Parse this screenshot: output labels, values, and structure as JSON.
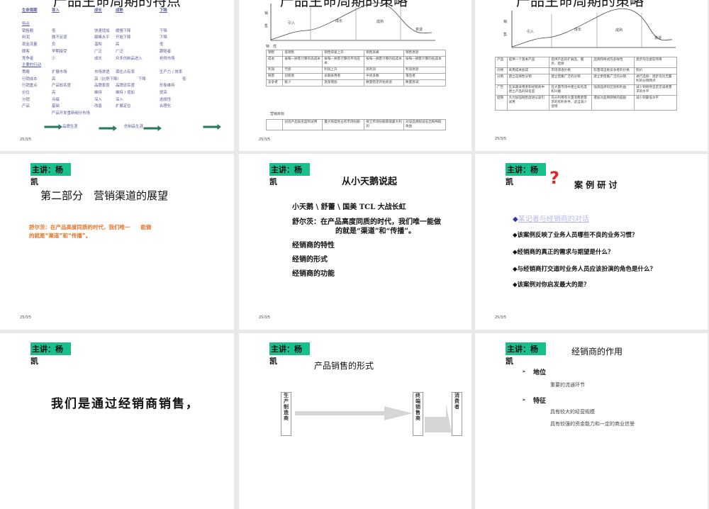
{
  "footer_date": "25/3/5",
  "speaker": {
    "line1": "主讲：杨",
    "line2": "凯"
  },
  "s1": {
    "title": "产品生命周期的特点",
    "header": [
      "生命周期",
      "导入",
      "成长",
      "成熟",
      "下降"
    ],
    "sec1": "特点",
    "rows1": [
      [
        "销售额",
        "低",
        "快速增加",
        "缓慢下降",
        "下降"
      ],
      [
        "利润",
        "微不足道",
        "巅峰水平",
        "开始下降",
        "下降"
      ],
      [
        "现金流量",
        "负",
        "温和",
        "高",
        "低"
      ],
      [
        "顾客",
        "早期接受",
        "广泛",
        "广泛",
        "跟随者"
      ],
      [
        "竞争者",
        "少",
        "成长",
        "众多仿制品进入",
        "抢得市场"
      ]
    ],
    "sec2": "主要的行动",
    "rows2": [
      [
        "策略",
        "扩展市场",
        "市场渗透",
        "保住占有率",
        "生产力 / 效率"
      ],
      [
        "行销成本",
        "高",
        "高（比例下降）",
        "下降",
        "低"
      ],
      [
        "行销重点",
        "产品知名度",
        "品牌表现",
        "品牌忠实度",
        "形象维持"
      ],
      [
        "价位",
        "高",
        "维持",
        "维持 / 增加",
        "提高"
      ],
      [
        "分销",
        "点缀",
        "深入",
        "深入",
        "选择性"
      ],
      [
        "产品",
        "基础",
        "改善",
        "扩展定位",
        "合理化"
      ]
    ],
    "extra": "产品开发重新细分市场",
    "arrow_labels": [
      "品牌生涯",
      "仿制品生涯"
    ]
  },
  "s2": {
    "title": "产品生命周期的策略",
    "chart": {
      "y_label": [
        "销",
        "售"
      ],
      "stages": [
        "引入",
        "成长",
        "成熟",
        "衰退"
      ]
    },
    "sec": "特　性",
    "table": [
      [
        "销售",
        "低销售",
        "销售快速上升",
        "销售高峰",
        "销售衰退"
      ],
      [
        "成本",
        "按每一顾客计算的高成本",
        "按每一顾客计算的平均成本",
        "按每一顾客计算的低成本",
        "按每一顾客计算的低成本"
      ],
      [
        "利润",
        "亏损",
        "利润上升",
        "高利润",
        "利润衰退"
      ],
      [
        "顾客",
        "创新者",
        "早期采用者",
        "中间多数",
        "落后者"
      ],
      [
        "竞争者",
        "极少",
        "逐渐增加",
        "数量稳定开始衰退",
        "数量衰减"
      ]
    ],
    "goal_label": "营销目标",
    "goals": [
      [
        "",
        "创造产品知名度和试用",
        "最大限度地占有市场份额",
        "保卫市场份额获取最大利润",
        "对该品牌削减支出和榨取收益"
      ]
    ]
  },
  "s3": {
    "title": "产品生命周期的策略",
    "chart": {
      "y_label": [
        "销",
        "售"
      ],
      "stages": [
        "引入",
        "成长",
        "成熟",
        "衰退"
      ]
    },
    "table": [
      [
        "产品",
        "提供一个基本产品",
        "提供产品的扩展品、服务、担保",
        "品牌和样式的多样性",
        "逐步淘汰疲软项目"
      ],
      [
        "价格",
        "采用成本加成",
        "市场渗透价格",
        "较量或击败竞争者的价格",
        "削价"
      ],
      [
        "分销",
        "建立选择性分销",
        "建立密集广泛的分销",
        "建立更密集广泛的分销",
        "进行选择：逐步淘汰无赢利的分销网点"
      ],
      [
        "广告",
        "在早期采用者和经销商中建立产品的知名度",
        "在大量市场中建立知名度和兴趣",
        "强调品牌的区别和利益",
        "减少到保持坚定忠诚者需求的水平"
      ],
      [
        "促销",
        "大力加强销售促进以吸引试用",
        "充分利用有大量消费者需求的有利条件，适当减少促销",
        "增加对品牌转换的鼓励",
        "减少到最低水平"
      ]
    ]
  },
  "s4": {
    "title": "第二部分　营销渠道的展望",
    "quote": [
      "舒尔茨：在产品高度同质的时代，我们唯一　　能做",
      "的就是“渠道”和“传播”。"
    ]
  },
  "s5": {
    "title": "从小天鹅说起",
    "items": [
      "小天鹅 \\ 舒蕾 \\ 国美 TCL 大战长虹",
      "舒尔茨：在产品高度同质的时代，我们唯一能做",
      "的就是“渠道”和“传播”。",
      "经销商的特性",
      "经销的形式",
      "经销商的功能"
    ]
  },
  "s6": {
    "title": "案 例 研 讨",
    "link": "某记者与经销商的对话",
    "questions": [
      "该案例反映了业务人员哪些不良的业务习惯？",
      "经销商的真正的需求与期望是什么？",
      "与经销商打交道时业务人员应该扮演的角色是什么？",
      "该案例对你启发最大的是？"
    ],
    "colors": {
      "link": "#b8b8e8",
      "bullet": "#3333aa"
    }
  },
  "s7": {
    "text": "我们是通过经销商销售，"
  },
  "s8": {
    "title": "产品销售的形式",
    "boxes": [
      "生产制造商",
      "终端销售商",
      "消费者"
    ]
  },
  "s9": {
    "title": "经销商的作用",
    "h1": "地位",
    "t1": "重要的流通环节",
    "h2": "特征",
    "t2": "具有较大的经营规模",
    "t3": "具有较强的资金能力和一定的商业信誉"
  }
}
